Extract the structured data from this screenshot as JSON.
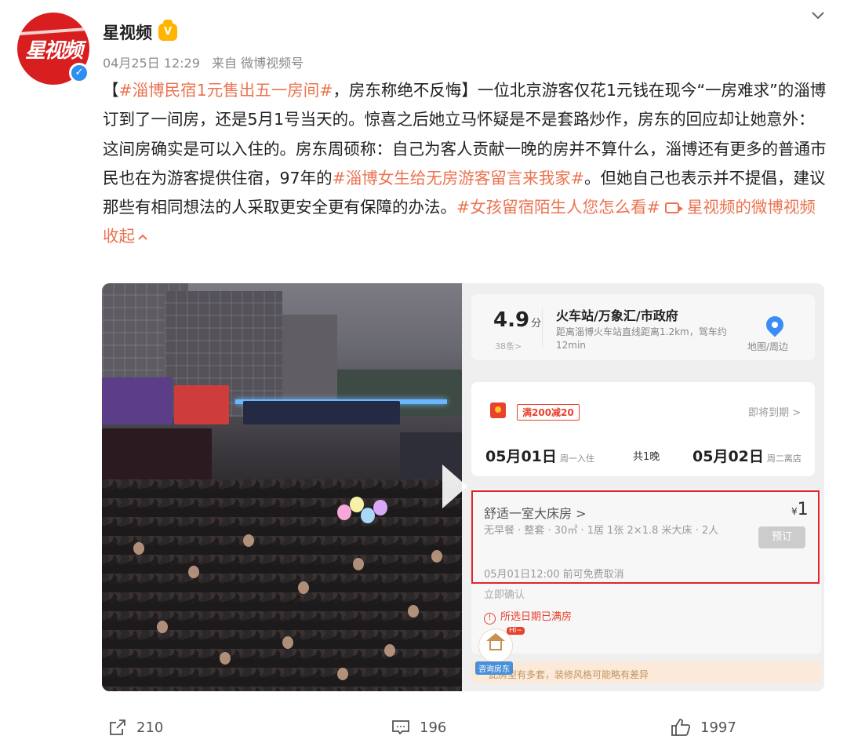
{
  "author": {
    "avatar_text": "星视频",
    "name": "星视频"
  },
  "meta": {
    "time": "04月25日 12:29",
    "source": "来自 微博视频号"
  },
  "post": {
    "p1": "【",
    "tag1": "#淄博民宿1元售出五一房间#",
    "p2": "，房东称绝不反悔】一位北京游客仅花1元钱在现今“一房难求”的淄博订到了一间房，还是5月1号当天的。惊喜之后她立马怀疑是不是套路炒作，房东的回应却让她意外：这间房确实是可以入住的。房东周硕称：自己为客人贡献一晚的房并不算什么，淄博还有更多的普通市民也在为游客提供住宿，97年的",
    "tag2": "#淄博女生给无房游客留言来我家#",
    "p3": "。但她自己也表示并不提倡，建议那些有相同想法的人采取更安全更有保障的办法。",
    "tag3": "#女孩留宿陌生人您怎么看#",
    "video_link": "星视频的微博视频",
    "collapse": "收起"
  },
  "screenshot": {
    "rating": "4.9",
    "rating_unit": "分",
    "reviews": "38条>",
    "location_title": "火车站/万象汇/市政府",
    "location_desc": "距离淄博火车站直线距离1.2km，驾车约12min",
    "map_label": "地图/周边",
    "coupon": "满200减20",
    "expire": "即将到期 >",
    "checkin_date": "05月01日",
    "checkin_sub": "周一入住",
    "nights": "共1晚",
    "checkout_date": "05月02日",
    "checkout_sub": "周二离店",
    "room_title": "舒适一室大床房 >",
    "room_price": "1",
    "room_price_symbol": "¥",
    "room_info": "无早餐 · 整套 · 30㎡ · 1居 1张 2×1.8 米大床 · 2人",
    "book_button": "预订",
    "cancel_policy": "05月01日12:00 前可免费取消",
    "instant_confirm": "立即确认",
    "sold_out": "所选日期已满房",
    "bottom_note": "此房型有多套，装修风格可能略有差异",
    "house_tag": "HI~",
    "house_label": "咨询房东"
  },
  "actions": {
    "share_count": "210",
    "comment_count": "196",
    "like_count": "1997"
  },
  "colors": {
    "link": "#eb7350",
    "highlight": "#e0262b",
    "verified": "#2f8ff0"
  }
}
